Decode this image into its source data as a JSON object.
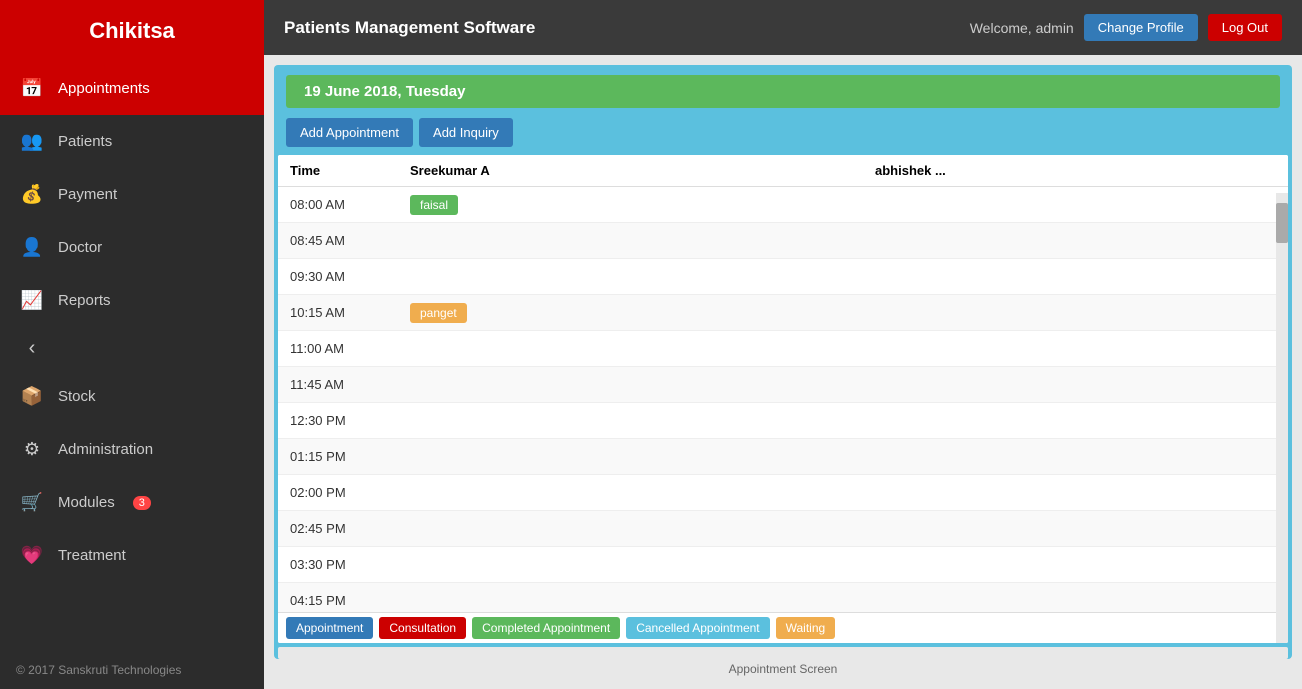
{
  "app": {
    "name": "Chikitsa",
    "subtitle": "Patients Management Software",
    "welcome": "Welcome, admin",
    "change_profile_label": "Change Profile",
    "logout_label": "Log Out"
  },
  "sidebar": {
    "items": [
      {
        "id": "appointments",
        "label": "Appointments",
        "icon": "📅",
        "active": true,
        "badge": null
      },
      {
        "id": "patients",
        "label": "Patients",
        "icon": "👥",
        "active": false,
        "badge": null
      },
      {
        "id": "payment",
        "label": "Payment",
        "icon": "💳",
        "active": false,
        "badge": null
      },
      {
        "id": "doctor",
        "label": "Doctor",
        "icon": "👤",
        "active": false,
        "badge": null
      },
      {
        "id": "reports",
        "label": "Reports",
        "icon": "📈",
        "active": false,
        "badge": null
      },
      {
        "id": "chevron",
        "label": "‹",
        "icon": "",
        "active": false,
        "badge": null,
        "is_chevron": true
      },
      {
        "id": "stock",
        "label": "Stock",
        "icon": "📦",
        "active": false,
        "badge": null
      },
      {
        "id": "administration",
        "label": "Administration",
        "icon": "⚙",
        "active": false,
        "badge": null
      },
      {
        "id": "modules",
        "label": "Modules",
        "icon": "🛒",
        "active": false,
        "badge": "3"
      },
      {
        "id": "treatment",
        "label": "Treatment",
        "icon": "💗",
        "active": false,
        "badge": null
      }
    ],
    "footer": "© 2017 Sanskruti Technologies"
  },
  "appointment_screen": {
    "date_label": "19 June 2018, Tuesday",
    "add_appointment_label": "Add Appointment",
    "add_inquiry_label": "Add Inquiry",
    "columns": [
      {
        "id": "time",
        "label": "Time"
      },
      {
        "id": "sreekumar",
        "label": "Sreekumar A"
      },
      {
        "id": "abhishek",
        "label": "abhishek ..."
      }
    ],
    "rows": [
      {
        "time": "08:00 AM",
        "sreekumar": "faisal",
        "sreekumar_color": "green",
        "abhishek": ""
      },
      {
        "time": "08:45 AM",
        "sreekumar": "",
        "abhishek": ""
      },
      {
        "time": "09:30 AM",
        "sreekumar": "",
        "abhishek": ""
      },
      {
        "time": "10:15 AM",
        "sreekumar": "panget",
        "sreekumar_color": "orange",
        "abhishek": ""
      },
      {
        "time": "11:00 AM",
        "sreekumar": "",
        "abhishek": ""
      },
      {
        "time": "11:45 AM",
        "sreekumar": "",
        "abhishek": ""
      },
      {
        "time": "12:30 PM",
        "sreekumar": "",
        "abhishek": ""
      },
      {
        "time": "01:15 PM",
        "sreekumar": "",
        "abhishek": ""
      },
      {
        "time": "02:00 PM",
        "sreekumar": "",
        "abhishek": ""
      },
      {
        "time": "02:45 PM",
        "sreekumar": "",
        "abhishek": ""
      },
      {
        "time": "03:30 PM",
        "sreekumar": "",
        "abhishek": ""
      },
      {
        "time": "04:15 PM",
        "sreekumar": "",
        "abhishek": ""
      }
    ],
    "legend": [
      {
        "label": "Appointment",
        "color": "appointment"
      },
      {
        "label": "Consultation",
        "color": "consultation"
      },
      {
        "label": "Completed Appointment",
        "color": "completed-appointment"
      },
      {
        "label": "Cancelled Appointment",
        "color": "cancelled-appointment"
      },
      {
        "label": "Waiting",
        "color": "waiting"
      }
    ],
    "caption": "Appointment Screen"
  }
}
